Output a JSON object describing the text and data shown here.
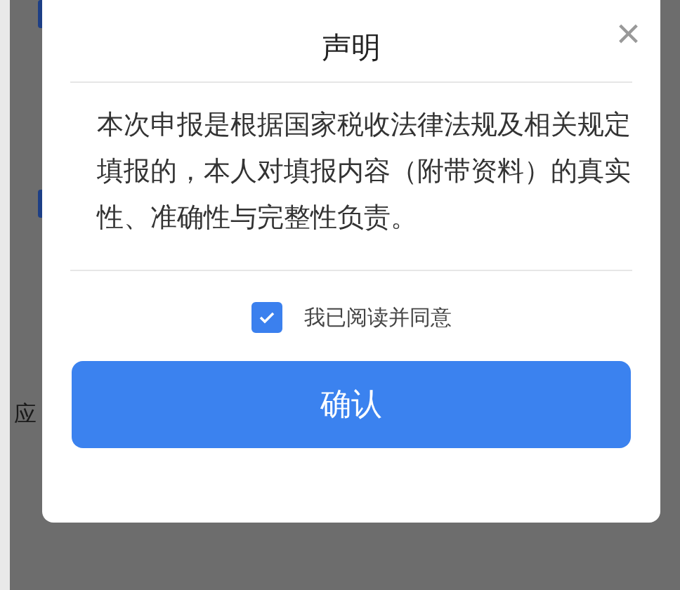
{
  "background": {
    "label": "应"
  },
  "dialog": {
    "title": "声明",
    "close": "×",
    "text": "本次申报是根据国家税收法律法规及相关规定填报的，本人对填报内容（附带资料）的真实性、准确性与完整性负责。",
    "agree": {
      "label": "我已阅读并同意",
      "checked": true
    },
    "button": "确认"
  }
}
